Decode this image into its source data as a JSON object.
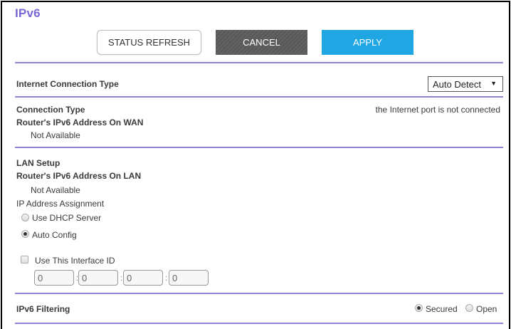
{
  "page": {
    "title": "IPv6"
  },
  "toolbar": {
    "refresh_label": "STATUS REFRESH",
    "cancel_label": "CANCEL",
    "apply_label": "APPLY"
  },
  "connection": {
    "internet_type_label": "Internet Connection Type",
    "internet_type_value": "Auto Detect",
    "connection_type_label": "Connection Type",
    "connection_type_value": "the Internet port is not connected",
    "wan_address_label": "Router's IPv6 Address On WAN",
    "wan_address_value": "Not Available"
  },
  "lan": {
    "section_label": "LAN Setup",
    "lan_address_label": "Router's IPv6 Address On LAN",
    "lan_address_value": "Not Available",
    "ip_assignment_label": "IP Address Assignment",
    "options": [
      "Use DHCP Server",
      "Auto Config"
    ],
    "selected_option": "Auto Config",
    "interface_id_label": "Use This Interface ID",
    "interface_id_checked": false,
    "interface_id_fields": [
      "0",
      "0",
      "0",
      "0"
    ]
  },
  "filtering": {
    "label": "IPv6 Filtering",
    "options": [
      "Secured",
      "Open"
    ],
    "selected": "Secured"
  },
  "colors": {
    "title": "#7b67d6",
    "divider": "#8d83d8",
    "cancel_bg": "#5c5c5c",
    "apply_bg": "#1fa6e3"
  }
}
